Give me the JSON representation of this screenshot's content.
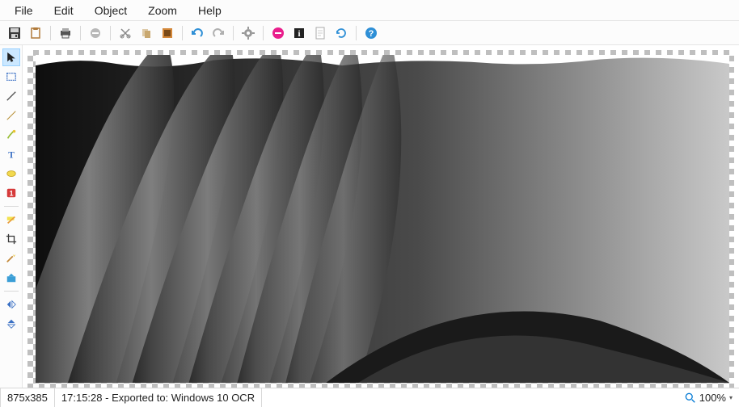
{
  "menu": {
    "file": "File",
    "edit": "Edit",
    "object": "Object",
    "zoom": "Zoom",
    "help": "Help"
  },
  "toolbar": {
    "save": "save",
    "paste": "paste",
    "print": "print",
    "disable": "disable",
    "cut": "cut",
    "copy": "copy",
    "copyall": "copyall",
    "undo": "undo",
    "redo": "redo",
    "settings": "settings",
    "cancel": "cancel",
    "info": "info",
    "page": "page",
    "refresh": "refresh",
    "help": "help"
  },
  "tools": {
    "pointer": "pointer",
    "select_rect": "select-rect",
    "line": "line",
    "pencil": "pencil",
    "brush": "brush",
    "text": "text",
    "shape": "shape",
    "number": "number",
    "highlight": "highlight",
    "crop": "crop",
    "effects": "effects",
    "color": "color",
    "flip_h": "flip-horizontal",
    "flip_v": "flip-vertical"
  },
  "status": {
    "dimensions": "875x385",
    "message_time": "17:15:28",
    "message_text": "Exported to: Windows 10 OCR",
    "zoom": "100%"
  },
  "colors": {
    "accent": "#0078d4",
    "cancel_pink": "#e91e8c",
    "brush_yellow": "#e8c22e"
  }
}
